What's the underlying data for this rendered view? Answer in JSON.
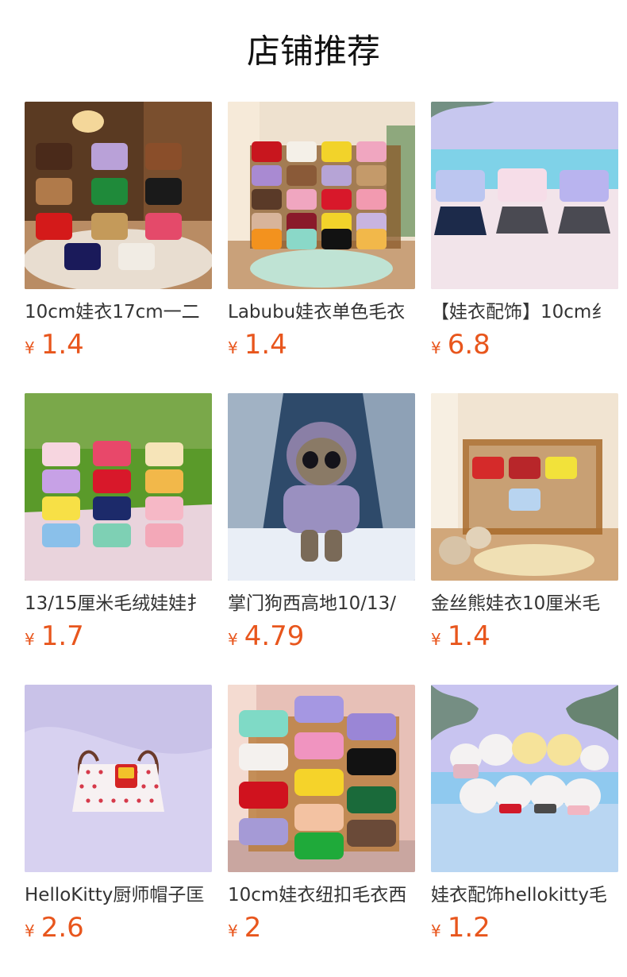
{
  "page": {
    "title": "店铺推荐"
  },
  "products": [
    {
      "name": "10cm娃衣17cm一二",
      "currency": "¥",
      "price": "1.4",
      "image_theme": "heart-sweaters-room",
      "image_icon": "sweater-pile-icon"
    },
    {
      "name": "Labubu娃衣单色毛衣",
      "currency": "¥",
      "price": "1.4",
      "image_theme": "color-sweaters-crib",
      "image_icon": "sweater-rack-icon"
    },
    {
      "name": "【娃衣配饰】10cm纟",
      "currency": "¥",
      "price": "6.8",
      "image_theme": "uniform-skirts-beach",
      "image_icon": "school-uniform-icon"
    },
    {
      "name": "13/15厘米毛绒娃娃扌",
      "currency": "¥",
      "price": "1.7",
      "image_theme": "dresses-picnic-park",
      "image_icon": "dress-stack-icon"
    },
    {
      "name": "掌门狗西高地10/13/",
      "currency": "¥",
      "price": "4.79",
      "image_theme": "hooded-plush-snow",
      "image_icon": "plush-doll-icon"
    },
    {
      "name": "金丝熊娃衣10厘米毛",
      "currency": "¥",
      "price": "1.4",
      "image_theme": "striped-sweaters-crib",
      "image_icon": "crib-icon"
    },
    {
      "name": "HelloKitty厨师帽子匡",
      "currency": "¥",
      "price": "2.6",
      "image_theme": "dotted-apron",
      "image_icon": "apron-icon"
    },
    {
      "name": "10cm娃衣纽扣毛衣西",
      "currency": "¥",
      "price": "2",
      "image_theme": "button-cardigans-shelf",
      "image_icon": "cardigan-shelf-icon"
    },
    {
      "name": "娃衣配饰hellokitty毛",
      "currency": "¥",
      "price": "1.2",
      "image_theme": "chef-hats-beach",
      "image_icon": "chef-hat-icon"
    }
  ],
  "colors": {
    "price": "#e8561d",
    "text": "#333333",
    "title": "#111111"
  }
}
